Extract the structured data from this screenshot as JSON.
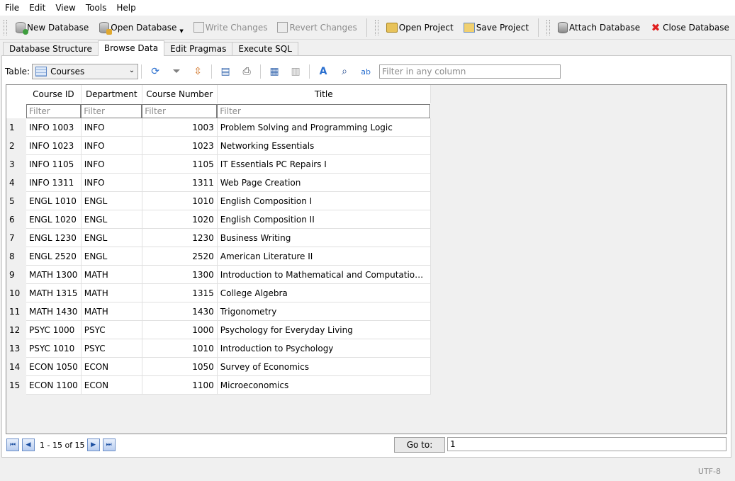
{
  "menu": [
    "File",
    "Edit",
    "View",
    "Tools",
    "Help"
  ],
  "toolbar": {
    "new_database": "New Database",
    "open_database": "Open Database",
    "write_changes": "Write Changes",
    "revert_changes": "Revert Changes",
    "open_project": "Open Project",
    "save_project": "Save Project",
    "attach_database": "Attach Database",
    "close_database": "Close Database"
  },
  "tabs": [
    "Database Structure",
    "Browse Data",
    "Edit Pragmas",
    "Execute SQL"
  ],
  "active_tab": "Browse Data",
  "browse": {
    "table_label": "Table:",
    "table_selected": "Courses",
    "filter_any_placeholder": "Filter in any column",
    "columns": [
      "Course ID",
      "Department",
      "Course Number",
      "Title"
    ],
    "filter_placeholder": "Filter",
    "rows": [
      {
        "n": "1",
        "id": "INFO 1003",
        "dept": "INFO",
        "num": "1003",
        "title": "Problem Solving and Programming Logic"
      },
      {
        "n": "2",
        "id": "INFO 1023",
        "dept": "INFO",
        "num": "1023",
        "title": "Networking Essentials"
      },
      {
        "n": "3",
        "id": "INFO 1105",
        "dept": "INFO",
        "num": "1105",
        "title": "IT Essentials PC Repairs I"
      },
      {
        "n": "4",
        "id": "INFO 1311",
        "dept": "INFO",
        "num": "1311",
        "title": "Web Page Creation"
      },
      {
        "n": "5",
        "id": "ENGL 1010",
        "dept": "ENGL",
        "num": "1010",
        "title": "English Composition I"
      },
      {
        "n": "6",
        "id": "ENGL 1020",
        "dept": "ENGL",
        "num": "1020",
        "title": "English Composition II"
      },
      {
        "n": "7",
        "id": "ENGL 1230",
        "dept": "ENGL",
        "num": "1230",
        "title": "Business Writing"
      },
      {
        "n": "8",
        "id": "ENGL 2520",
        "dept": "ENGL",
        "num": "2520",
        "title": "American Literature II"
      },
      {
        "n": "9",
        "id": "MATH 1300",
        "dept": "MATH",
        "num": "1300",
        "title": "Introduction to Mathematical and Computational ..."
      },
      {
        "n": "10",
        "id": "MATH 1315",
        "dept": "MATH",
        "num": "1315",
        "title": "College Algebra"
      },
      {
        "n": "11",
        "id": "MATH 1430",
        "dept": "MATH",
        "num": "1430",
        "title": "Trigonometry"
      },
      {
        "n": "12",
        "id": "PSYC 1000",
        "dept": "PSYC",
        "num": "1000",
        "title": "Psychology for Everyday Living"
      },
      {
        "n": "13",
        "id": "PSYC 1010",
        "dept": "PSYC",
        "num": "1010",
        "title": "Introduction to Psychology"
      },
      {
        "n": "14",
        "id": "ECON 1050",
        "dept": "ECON",
        "num": "1050",
        "title": "Survey of Economics"
      },
      {
        "n": "15",
        "id": "ECON 1100",
        "dept": "ECON",
        "num": "1100",
        "title": "Microeconomics"
      }
    ]
  },
  "pagination": {
    "range_text": "1 - 15 of 15",
    "goto_label": "Go to:",
    "goto_value": "1"
  },
  "status": {
    "encoding": "UTF-8"
  }
}
